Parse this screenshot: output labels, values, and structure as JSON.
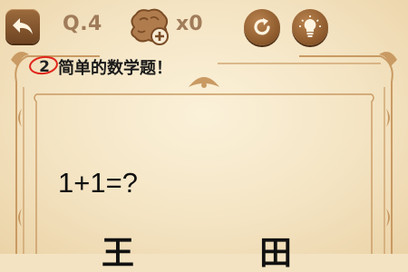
{
  "header": {
    "level_label": "Q.4",
    "hint_count": "x0",
    "icons": {
      "back": "back-arrow-icon",
      "hints": "brain-plus-icon",
      "retry": "retry-icon",
      "hint_bulb": "lightbulb-icon"
    }
  },
  "question": {
    "number": "2",
    "title": "简单的数学题！",
    "equation": "1+1=?"
  },
  "answers": {
    "left": "王",
    "right": "田"
  },
  "colors": {
    "background": "#f3e3c2",
    "button_brown": "#8e5b2d",
    "label_tan": "#a07c5a",
    "frame_line": "#c99a63",
    "highlight_red": "#e0261c"
  }
}
